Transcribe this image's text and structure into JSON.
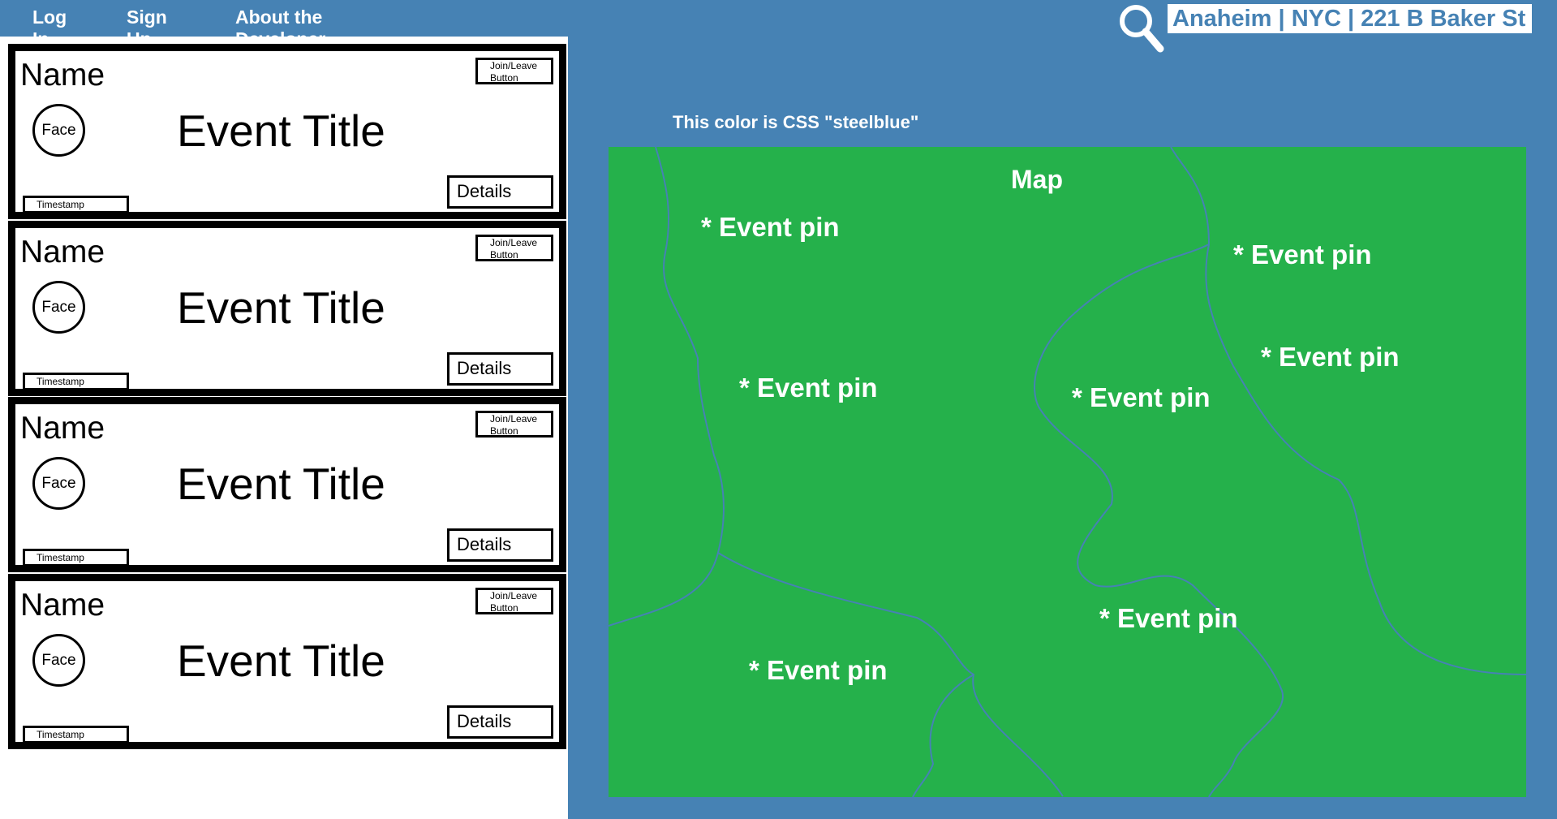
{
  "nav": {
    "login": "Log In",
    "signup": "Sign Up",
    "about": "About the Developer"
  },
  "search": {
    "value": "Anaheim | NYC | 221 B Baker St",
    "icon": "search-icon"
  },
  "cards": [
    {
      "name": "Name",
      "face": "Face",
      "title": "Event Title",
      "join": "Join/Leave\nButton",
      "details": "Details",
      "timestamp": "Timestamp"
    },
    {
      "name": "Name",
      "face": "Face",
      "title": "Event Title",
      "join": "Join/Leave\nButton",
      "details": "Details",
      "timestamp": "Timestamp"
    },
    {
      "name": "Name",
      "face": "Face",
      "title": "Event Title",
      "join": "Join/Leave\nButton",
      "details": "Details",
      "timestamp": "Timestamp"
    },
    {
      "name": "Name",
      "face": "Face",
      "title": "Event Title",
      "join": "Join/Leave\nButton",
      "details": "Details",
      "timestamp": "Timestamp"
    }
  ],
  "map": {
    "caption": "This color is CSS \"steelblue\"",
    "title": "Map",
    "pins": [
      "* Event pin",
      "* Event pin",
      "* Event pin",
      "* Event pin",
      "* Event pin",
      "* Event pin",
      "* Event pin"
    ]
  },
  "colors": {
    "background": "#4682b4",
    "map": "#25b14b",
    "road": "#4682b4",
    "text_on_dark": "#ffffff"
  }
}
